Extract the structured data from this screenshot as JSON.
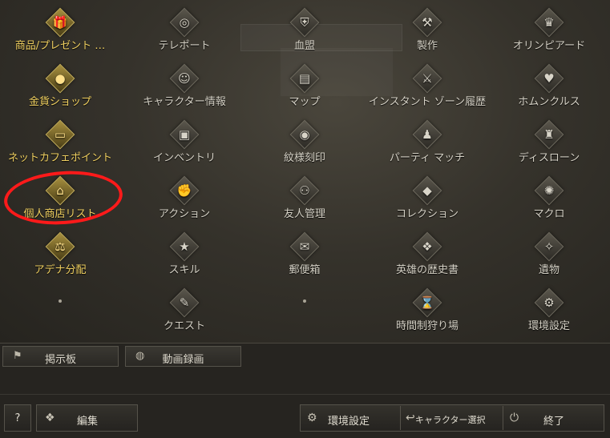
{
  "menu": {
    "items": [
      {
        "label": "商品/プレゼント …",
        "icon": "gift-icon",
        "glyph": "🎁",
        "gold": true
      },
      {
        "label": "テレポート",
        "icon": "teleport-icon",
        "glyph": "◎",
        "gold": false
      },
      {
        "label": "血盟",
        "icon": "clan-shield-icon",
        "glyph": "⛨",
        "gold": false
      },
      {
        "label": "製作",
        "icon": "crafting-icon",
        "glyph": "⚒",
        "gold": false
      },
      {
        "label": "オリンピアード",
        "icon": "olympiad-icon",
        "glyph": "♛",
        "gold": false
      },
      {
        "label": "金貨ショップ",
        "icon": "gold-shop-icon",
        "glyph": "●",
        "gold": true
      },
      {
        "label": "キャラクター情報",
        "icon": "character-info-icon",
        "glyph": "☺",
        "gold": false
      },
      {
        "label": "マップ",
        "icon": "map-icon",
        "glyph": "▤",
        "gold": false
      },
      {
        "label": "インスタント ゾーン履歴",
        "icon": "instant-zone-icon",
        "glyph": "⚔",
        "gold": false
      },
      {
        "label": "ホムンクルス",
        "icon": "homunculus-icon",
        "glyph": "♥",
        "gold": false
      },
      {
        "label": "ネットカフェポイント",
        "icon": "net-cafe-icon",
        "glyph": "▭",
        "gold": true
      },
      {
        "label": "インベントリ",
        "icon": "inventory-icon",
        "glyph": "▣",
        "gold": false
      },
      {
        "label": "紋様刻印",
        "icon": "pattern-engrave-icon",
        "glyph": "◉",
        "gold": false
      },
      {
        "label": "パーティ マッチ",
        "icon": "party-match-icon",
        "glyph": "♟",
        "gold": false
      },
      {
        "label": "ディスローン",
        "icon": "dethrone-icon",
        "glyph": "♜",
        "gold": false
      },
      {
        "label": "個人商店リスト",
        "icon": "private-store-icon",
        "glyph": "⌂",
        "gold": true
      },
      {
        "label": "アクション",
        "icon": "action-icon",
        "glyph": "✊",
        "gold": false
      },
      {
        "label": "友人管理",
        "icon": "friends-icon",
        "glyph": "⚇",
        "gold": false
      },
      {
        "label": "コレクション",
        "icon": "collection-icon",
        "glyph": "◆",
        "gold": false
      },
      {
        "label": "マクロ",
        "icon": "macro-icon",
        "glyph": "✺",
        "gold": false
      },
      {
        "label": "アデナ分配",
        "icon": "adena-distribution-icon",
        "glyph": "⚖",
        "gold": true
      },
      {
        "label": "スキル",
        "icon": "skill-icon",
        "glyph": "★",
        "gold": false
      },
      {
        "label": "郵便箱",
        "icon": "mailbox-icon",
        "glyph": "✉",
        "gold": false
      },
      {
        "label": "英雄の歴史書",
        "icon": "hero-history-icon",
        "glyph": "❖",
        "gold": false
      },
      {
        "label": "遺物",
        "icon": "relic-icon",
        "glyph": "✧",
        "gold": false
      },
      {
        "label": "",
        "icon": "",
        "glyph": "",
        "gold": false,
        "empty": true
      },
      {
        "label": "クエスト",
        "icon": "quest-icon",
        "glyph": "✎",
        "gold": false
      },
      {
        "label": "",
        "icon": "",
        "glyph": "",
        "gold": false,
        "empty": true
      },
      {
        "label": "時間制狩り場",
        "icon": "timed-hunting-icon",
        "glyph": "⌛",
        "gold": false
      },
      {
        "label": "環境設定",
        "icon": "settings-icon",
        "glyph": "⚙",
        "gold": false
      }
    ]
  },
  "row_buttons": {
    "bulletin": "掲示板",
    "video": "動画録画"
  },
  "footer": {
    "help": "?",
    "edit": "編集",
    "settings": "環境設定",
    "char_select": "キャラクター選択",
    "quit": "終了"
  },
  "colors": {
    "highlight_circle": "#ff1a1a",
    "gold_label": "#f0d060",
    "normal_label": "#d6d2c6"
  }
}
